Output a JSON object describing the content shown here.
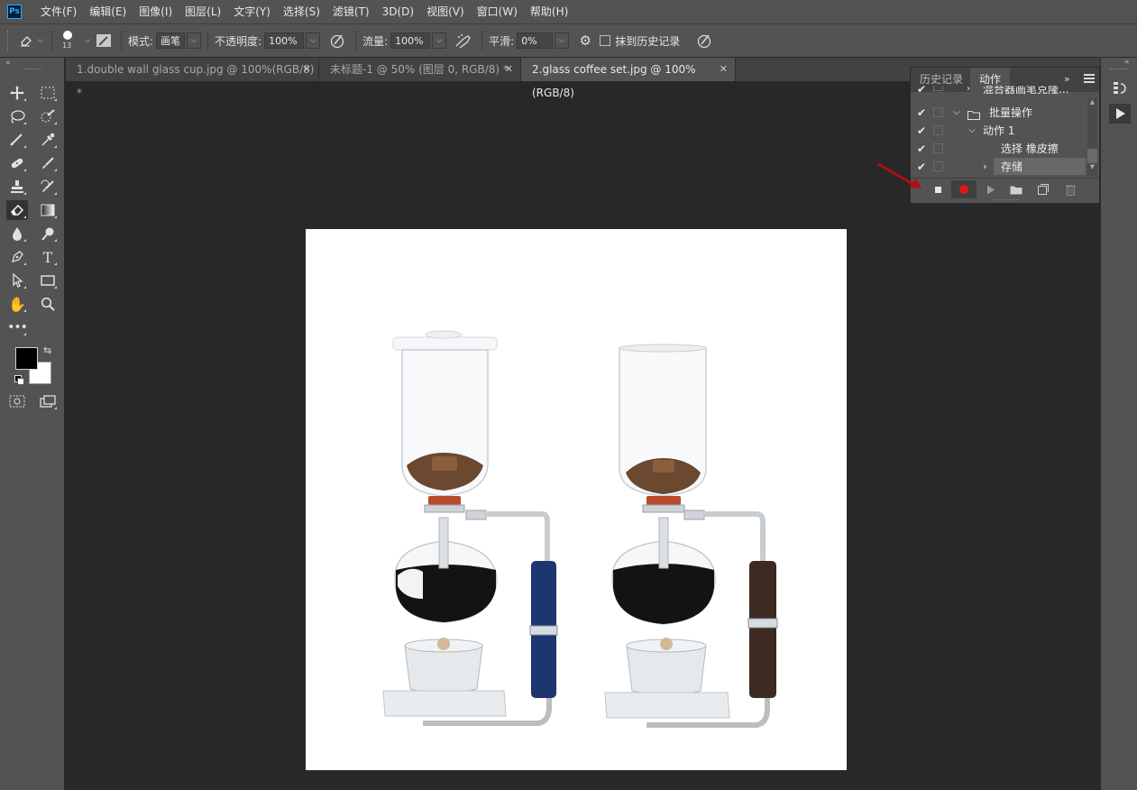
{
  "app": {
    "logo_text": "Ps"
  },
  "menubar": {
    "items": [
      "文件(F)",
      "编辑(E)",
      "图像(I)",
      "图层(L)",
      "文字(Y)",
      "选择(S)",
      "滤镜(T)",
      "3D(D)",
      "视图(V)",
      "窗口(W)",
      "帮助(H)"
    ]
  },
  "options": {
    "brush_size": "13",
    "mode_label": "模式:",
    "mode_value": "画笔",
    "opacity_label": "不透明度:",
    "opacity_value": "100%",
    "flow_label": "流量:",
    "flow_value": "100%",
    "smoothing_label": "平滑:",
    "smoothing_value": "0%",
    "erase_history_label": "抹到历史记录",
    "erase_history_checked": false
  },
  "tabs": [
    {
      "label": "1.double wall glass cup.jpg @ 100%(RGB/8) *",
      "close": "✕",
      "active": false
    },
    {
      "label": "未标题-1 @ 50% (图层 0, RGB/8) *",
      "close": "✕",
      "active": false
    },
    {
      "label": "2.glass coffee set.jpg @ 100%(RGB/8)",
      "close": "✕",
      "active": true
    }
  ],
  "panel": {
    "tabs": [
      "历史记录",
      "动作"
    ],
    "active_tab": "动作",
    "rows": [
      {
        "label": "混合器画笔克隆...",
        "checked": true,
        "level": 0
      },
      {
        "label": "批量操作",
        "checked": true,
        "level": 0
      },
      {
        "label": "动作 1",
        "checked": true,
        "level": 1
      },
      {
        "label": "选择 橡皮擦",
        "checked": true,
        "level": 2
      },
      {
        "label": "存储",
        "checked": true,
        "level": 2
      }
    ]
  },
  "colors": {
    "foreground": "#000000",
    "background": "#ffffff",
    "record_red": "#e01818",
    "annotation_arrow": "#b01010",
    "blue_handle": "#1e3670",
    "brown_handle": "#3d2a22"
  }
}
